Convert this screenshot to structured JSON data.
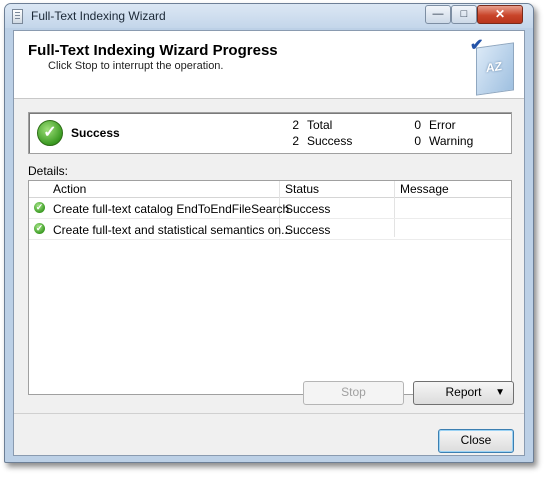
{
  "window": {
    "title": "Full-Text Indexing Wizard"
  },
  "header": {
    "title": "Full-Text Indexing Wizard Progress",
    "subtitle": "Click Stop to interrupt the operation.",
    "logo_text": "AZ"
  },
  "summary": {
    "status": "Success",
    "total_count": "2",
    "total_label": "Total",
    "success_count": "2",
    "success_label": "Success",
    "error_count": "0",
    "error_label": "Error",
    "warning_count": "0",
    "warning_label": "Warning"
  },
  "details": {
    "label": "Details:",
    "columns": [
      "Action",
      "Status",
      "Message"
    ],
    "rows": [
      {
        "action": "Create full-text catalog EndToEndFileSearch",
        "status": "Success",
        "message": ""
      },
      {
        "action": "Create full-text and statistical semantics on...",
        "status": "Success",
        "message": ""
      }
    ]
  },
  "buttons": {
    "stop": "Stop",
    "report": "Report",
    "close": "Close"
  },
  "colors": {
    "success_green": "#3b9a22",
    "accent_blue": "#3c7fb1"
  }
}
